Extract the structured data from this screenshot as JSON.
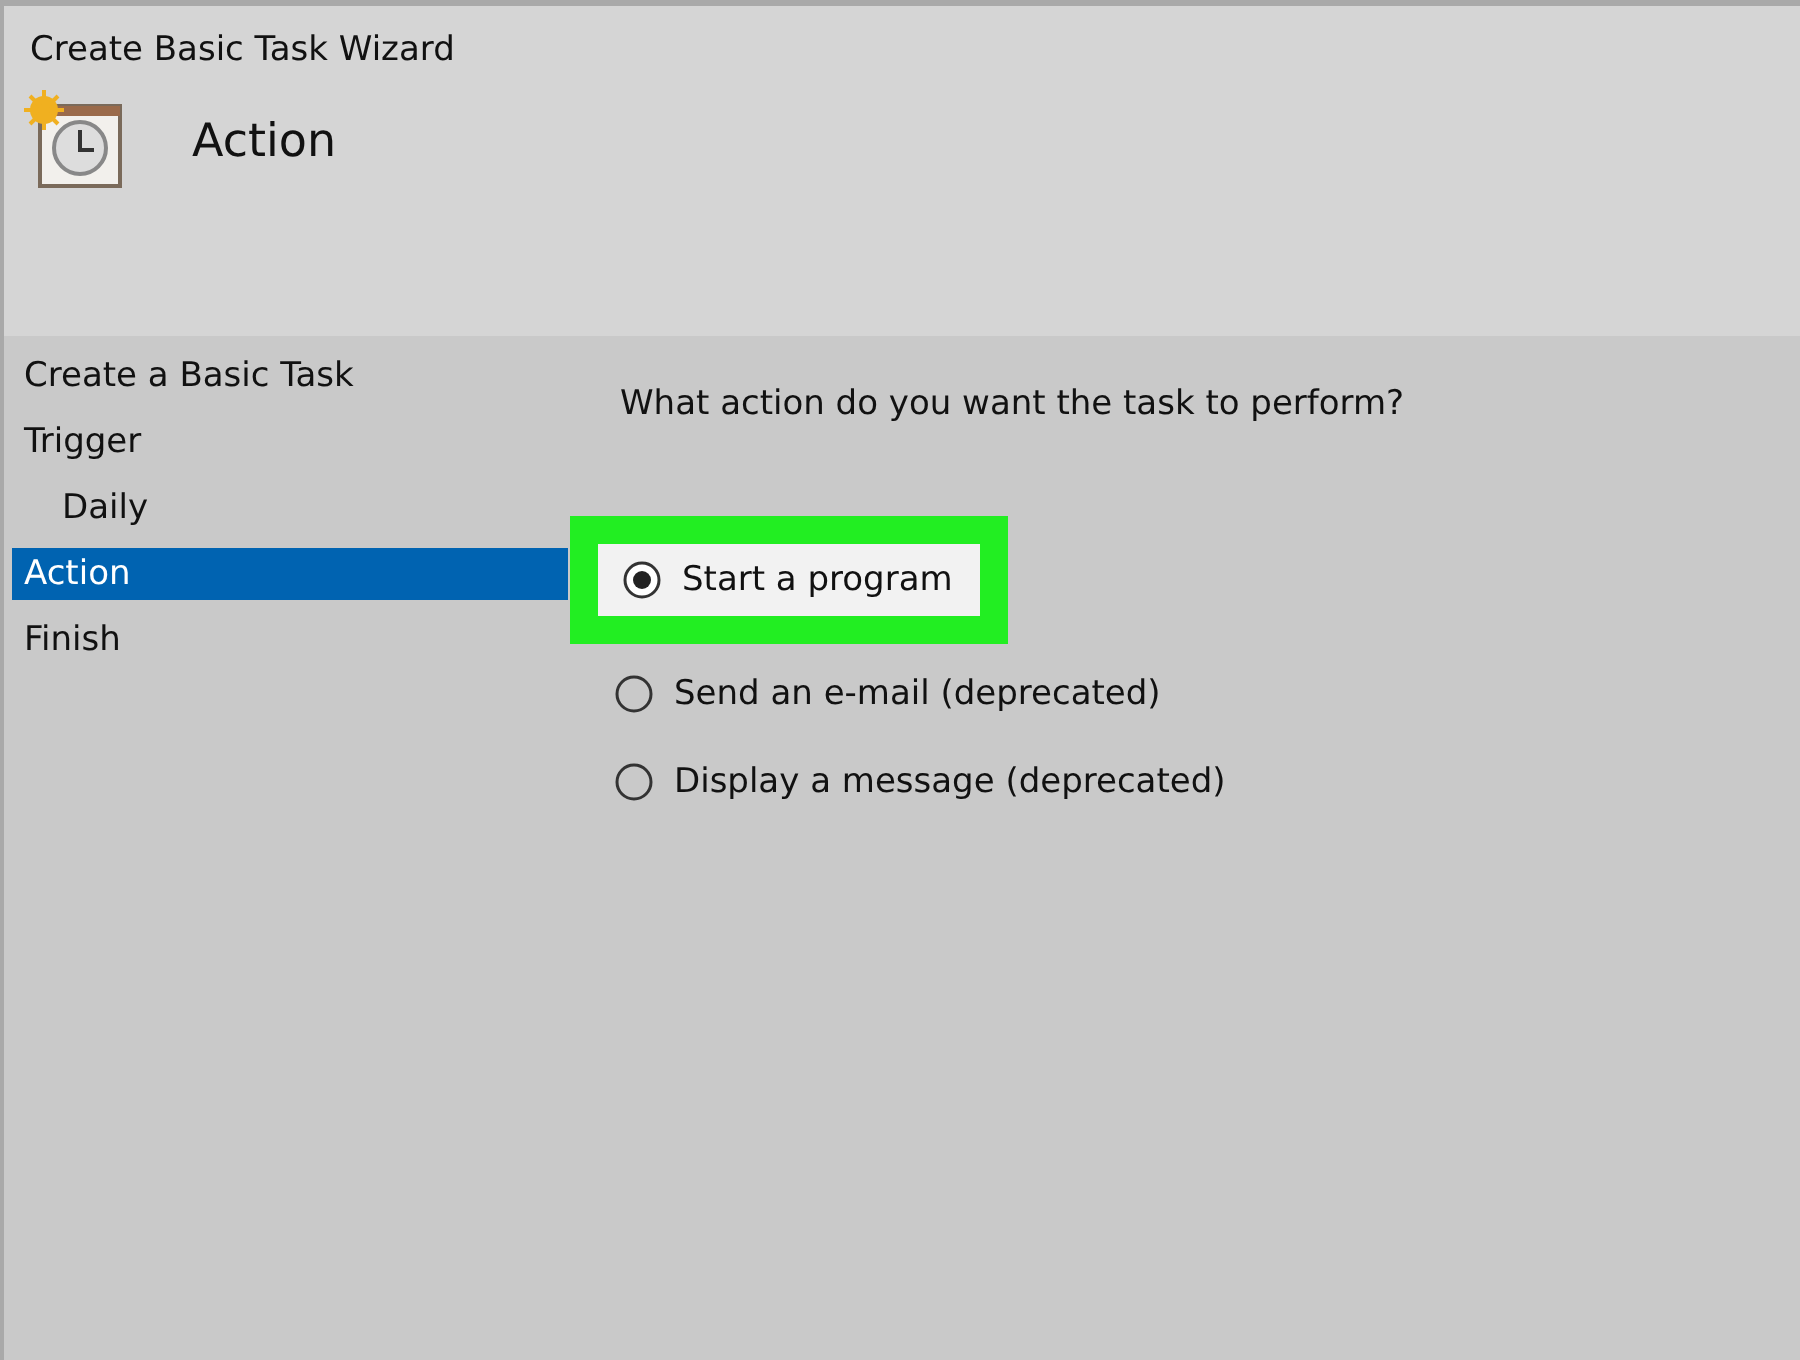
{
  "window": {
    "title": "Create Basic Task Wizard"
  },
  "header": {
    "title": "Action"
  },
  "steps": [
    {
      "label": "Create a Basic Task",
      "selected": false
    },
    {
      "label": "Trigger",
      "selected": false,
      "children": [
        {
          "label": "Daily",
          "selected": false
        }
      ]
    },
    {
      "label": "Action",
      "selected": true
    },
    {
      "label": "Finish",
      "selected": false
    }
  ],
  "question": "What action do you want the task to perform?",
  "options": [
    {
      "label": "Start a program",
      "selected": true,
      "highlighted": true
    },
    {
      "label": "Send an e-mail (deprecated)",
      "selected": false,
      "highlighted": false
    },
    {
      "label": "Display a message (deprecated)",
      "selected": false,
      "highlighted": false
    }
  ]
}
